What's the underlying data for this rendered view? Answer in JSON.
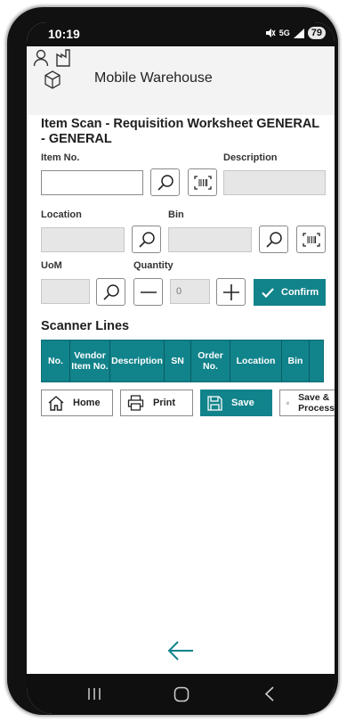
{
  "status": {
    "time": "10:19",
    "network": "5G",
    "battery": "79"
  },
  "app": {
    "title": "Mobile Warehouse"
  },
  "page": {
    "heading": "Item Scan - Requisition Worksheet GENERAL - GENERAL"
  },
  "form": {
    "item_no_label": "Item No.",
    "description_label": "Description",
    "location_label": "Location",
    "bin_label": "Bin",
    "uom_label": "UoM",
    "quantity_label": "Quantity",
    "quantity_placeholder": "0",
    "confirm_label": "Confirm"
  },
  "scanner": {
    "title": "Scanner Lines",
    "columns": [
      "No.",
      "Vendor Item No.",
      "Description",
      "SN",
      "Order No.",
      "Location",
      "Bin"
    ]
  },
  "actions": {
    "home": "Home",
    "print": "Print",
    "save": "Save",
    "save_proc": "Save & Process"
  },
  "colors": {
    "accent": "#11838b"
  },
  "icons": [
    "user-icon",
    "factory-icon",
    "cube-icon",
    "search-icon",
    "barcode-icon",
    "minus-icon",
    "plus-icon",
    "check-icon",
    "home-icon",
    "printer-icon",
    "save-icon",
    "save-process-icon",
    "back-arrow-icon"
  ]
}
